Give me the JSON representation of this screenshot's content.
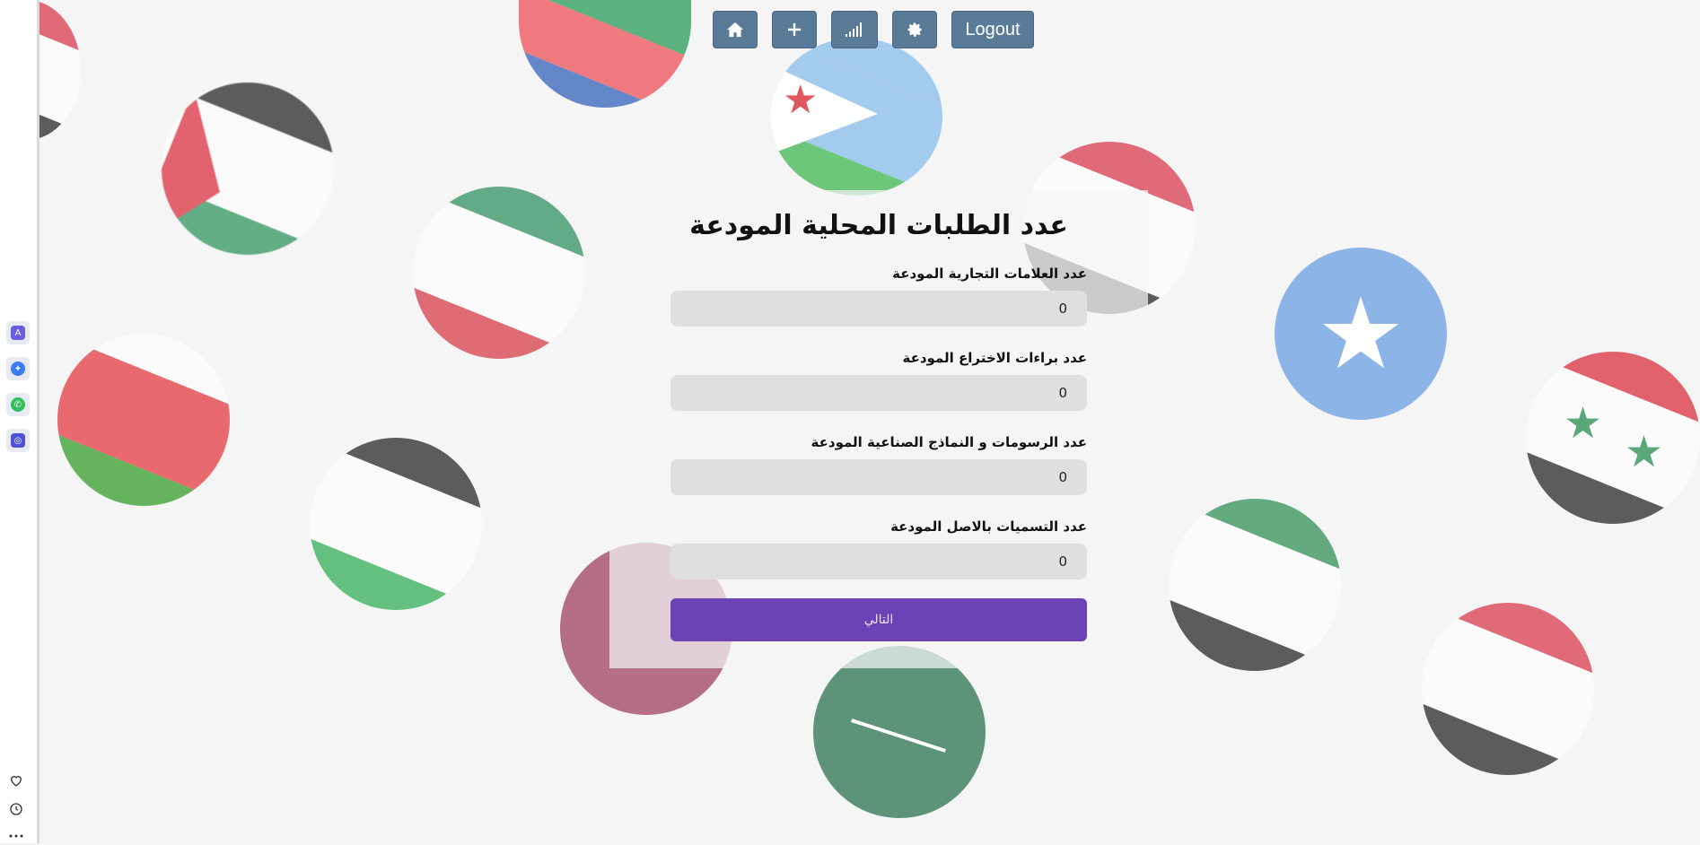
{
  "nav": {
    "home_icon": "home-icon",
    "add_icon": "plus-icon",
    "stats_icon": "signal-bars-icon",
    "settings_icon": "gear-icon",
    "logout_label": "Logout"
  },
  "form": {
    "title": "عدد الطلبات المحلية المودعة",
    "fields": [
      {
        "label": "عدد العلامات التجارية المودعة",
        "value": "0"
      },
      {
        "label": "عدد براءات الاختراع المودعة",
        "value": "0"
      },
      {
        "label": "عدد الرسومات و النماذج الصناعية المودعة",
        "value": "0"
      },
      {
        "label": "عدد التسميات بالاصل المودعة",
        "value": "0"
      }
    ],
    "next_label": "التالي"
  },
  "sidebar": {
    "apps": [
      "app-launcher-icon",
      "messenger-icon",
      "whatsapp-icon",
      "assistant-icon"
    ],
    "bottom": [
      "heart-icon",
      "clock-icon",
      "more-icon"
    ]
  },
  "colors": {
    "nav_button": "#5a7b98",
    "next_button": "#6b43b7",
    "input_bg": "#e0dfe0"
  }
}
